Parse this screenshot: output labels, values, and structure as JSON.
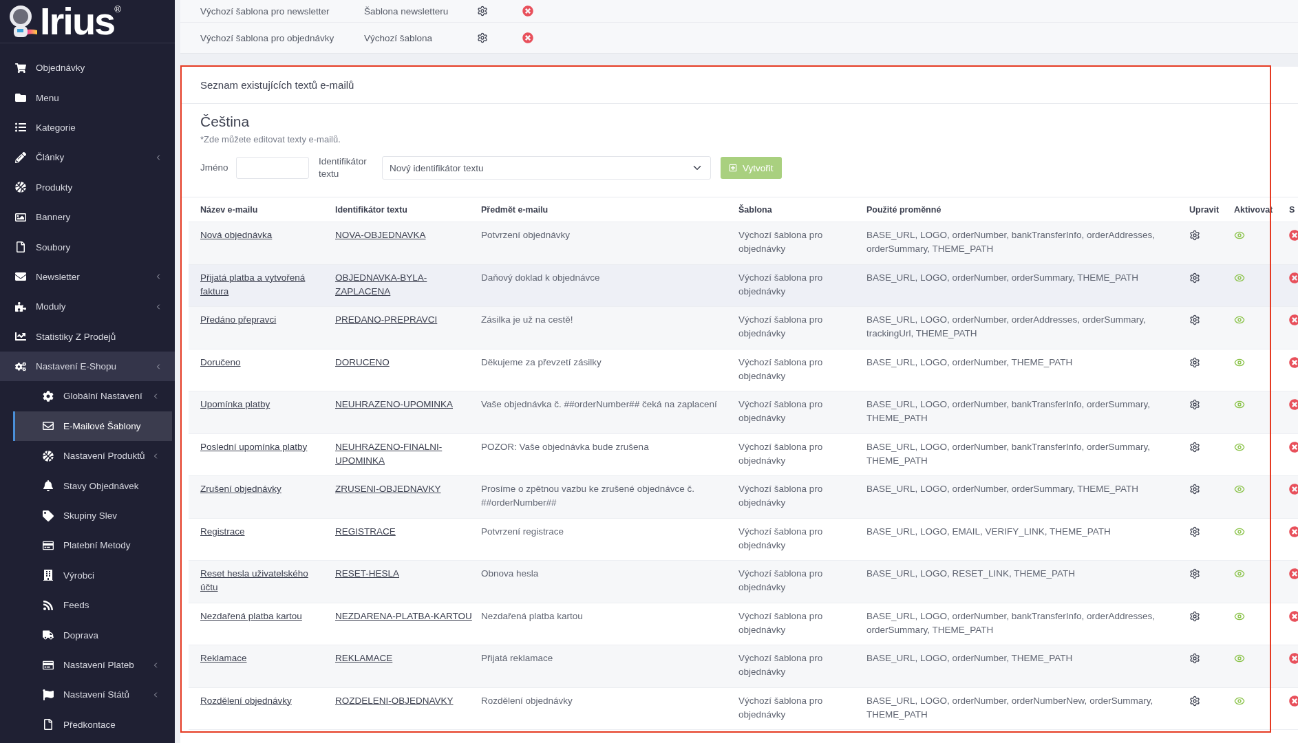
{
  "sidebar": {
    "logo": {
      "text": "Irius",
      "mark": "®"
    },
    "items": [
      {
        "label": "Objednávky",
        "has_submenu": false,
        "expanded": false,
        "selected": false
      },
      {
        "label": "Menu",
        "has_submenu": false,
        "expanded": false,
        "selected": false
      },
      {
        "label": "Kategorie",
        "has_submenu": false,
        "expanded": false,
        "selected": false
      },
      {
        "label": "Články",
        "has_submenu": true,
        "expanded": false,
        "selected": false
      },
      {
        "label": "Produkty",
        "has_submenu": false,
        "expanded": false,
        "selected": false
      },
      {
        "label": "Bannery",
        "has_submenu": false,
        "expanded": false,
        "selected": false
      },
      {
        "label": "Soubory",
        "has_submenu": false,
        "expanded": false,
        "selected": false
      },
      {
        "label": "Newsletter",
        "has_submenu": true,
        "expanded": false,
        "selected": false
      },
      {
        "label": "Moduly",
        "has_submenu": true,
        "expanded": false,
        "selected": false
      },
      {
        "label": "Statistiky Z Prodejů",
        "has_submenu": false,
        "expanded": false,
        "selected": false
      },
      {
        "label": "Nastavení E-Shopu",
        "has_submenu": true,
        "expanded": true,
        "selected": false,
        "children": [
          {
            "label": "Globální Nastavení",
            "has_submenu": true,
            "selected": false
          },
          {
            "label": "E-Mailové Šablony",
            "has_submenu": false,
            "selected": true
          },
          {
            "label": "Nastavení Produktů",
            "has_submenu": true,
            "selected": false
          },
          {
            "label": "Stavy Objednávek",
            "has_submenu": false,
            "selected": false
          },
          {
            "label": "Skupiny Slev",
            "has_submenu": false,
            "selected": false
          },
          {
            "label": "Platební Metody",
            "has_submenu": false,
            "selected": false
          },
          {
            "label": "Výrobci",
            "has_submenu": false,
            "selected": false
          },
          {
            "label": "Feeds",
            "has_submenu": false,
            "selected": false
          },
          {
            "label": "Doprava",
            "has_submenu": false,
            "selected": false
          },
          {
            "label": "Nastavení Plateb",
            "has_submenu": true,
            "selected": false
          },
          {
            "label": "Nastavení Států",
            "has_submenu": true,
            "selected": false
          },
          {
            "label": "Předkontace",
            "has_submenu": false,
            "selected": false
          }
        ]
      }
    ]
  },
  "templates": [
    {
      "name": "Výchozí šablona pro newsletter",
      "template": "Šablona newsletteru"
    },
    {
      "name": "Výchozí šablona pro objednávky",
      "template": "Výchozí šablona"
    }
  ],
  "texts_card": {
    "title": "Seznam existujících textů e-mailů",
    "language": "Čeština",
    "note": "*Zde můžete editovat texty e-mailů.",
    "form": {
      "name_label": "Jméno",
      "identifier_label": "Identifikátor textu",
      "identifier_value": "Nový identifikátor textu",
      "create_button": "Vytvořit"
    },
    "table": {
      "columns": [
        "Název e-mailu",
        "Identifikátor textu",
        "Předmět e-mailu",
        "Šablona",
        "Použité proměnné",
        "Upravit",
        "Aktivovat",
        "S"
      ],
      "rows": [
        {
          "name": "Nová objednávka",
          "identifier": "NOVA-OBJEDNAVKA",
          "subject": "Potvrzení objednávky",
          "template": "Výchozí šablona pro objednávky",
          "variables": "BASE_URL, LOGO, orderNumber, bankTransferInfo, orderAddresses, orderSummary, THEME_PATH",
          "active": true,
          "highlighted": false
        },
        {
          "name": "Přijatá platba a vytvořená faktura",
          "identifier": "OBJEDNAVKA-BYLA-ZAPLACENA",
          "subject": "Daňový doklad k objednávce",
          "template": "Výchozí šablona pro objednávky",
          "variables": "BASE_URL, LOGO, orderNumber, orderSummary, THEME_PATH",
          "active": true,
          "highlighted": true
        },
        {
          "name": "Předáno přepravci",
          "identifier": "PREDANO-PREPRAVCI",
          "subject": "Zásilka je už na cestě!",
          "template": "Výchozí šablona pro objednávky",
          "variables": "BASE_URL, LOGO, orderNumber, orderAddresses, orderSummary, trackingUrl, THEME_PATH",
          "active": true,
          "highlighted": false
        },
        {
          "name": "Doručeno",
          "identifier": "DORUCENO",
          "subject": "Děkujeme za převzetí zásilky",
          "template": "Výchozí šablona pro objednávky",
          "variables": "BASE_URL, LOGO, orderNumber, THEME_PATH",
          "active": true,
          "highlighted": false
        },
        {
          "name": "Upomínka platby",
          "identifier": "NEUHRAZENO-UPOMINKA",
          "subject": "Vaše objednávka č. ##orderNumber## čeká na zaplacení",
          "template": "Výchozí šablona pro objednávky",
          "variables": "BASE_URL, LOGO, orderNumber, bankTransferInfo, orderSummary, THEME_PATH",
          "active": true,
          "highlighted": false
        },
        {
          "name": "Poslední upomínka platby",
          "identifier": "NEUHRAZENO-FINALNI-UPOMINKA",
          "subject": "POZOR: Vaše objednávka bude zrušena",
          "template": "Výchozí šablona pro objednávky",
          "variables": "BASE_URL, LOGO, orderNumber, bankTransferInfo, orderSummary, THEME_PATH",
          "active": true,
          "highlighted": false
        },
        {
          "name": "Zrušení objednávky",
          "identifier": "ZRUSENI-OBJEDNAVKY",
          "subject": "Prosíme o zpětnou vazbu ke zrušené objednávce č. ##orderNumber##",
          "template": "Výchozí šablona pro objednávky",
          "variables": "BASE_URL, LOGO, orderNumber, orderSummary, THEME_PATH",
          "active": true,
          "highlighted": false
        },
        {
          "name": "Registrace",
          "identifier": "REGISTRACE",
          "subject": "Potvrzení registrace",
          "template": "Výchozí šablona pro objednávky",
          "variables": "BASE_URL, LOGO, EMAIL, VERIFY_LINK, THEME_PATH",
          "active": true,
          "highlighted": false
        },
        {
          "name": "Reset hesla uživatelského účtu",
          "identifier": "RESET-HESLA",
          "subject": "Obnova hesla",
          "template": "Výchozí šablona pro objednávky",
          "variables": "BASE_URL, LOGO, RESET_LINK, THEME_PATH",
          "active": true,
          "highlighted": false
        },
        {
          "name": "Nezdařená platba kartou",
          "identifier": "NEZDARENA-PLATBA-KARTOU",
          "subject": "Nezdařená platba kartou",
          "template": "Výchozí šablona pro objednávky",
          "variables": "BASE_URL, LOGO, orderNumber, bankTransferInfo, orderAddresses, orderSummary, THEME_PATH",
          "active": true,
          "highlighted": false
        },
        {
          "name": "Reklamace",
          "identifier": "REKLAMACE",
          "subject": "Přijatá reklamace",
          "template": "Výchozí šablona pro objednávky",
          "variables": "BASE_URL, LOGO, orderNumber, THEME_PATH",
          "active": true,
          "highlighted": false
        },
        {
          "name": "Rozdělení objednávky",
          "identifier": "ROZDELENI-OBJEDNAVKY",
          "subject": "Rozdělení objednávky",
          "template": "Výchozí šablona pro objednávky",
          "variables": "BASE_URL, LOGO, orderNumber, orderNumberNew, orderSummary, THEME_PATH",
          "active": true,
          "highlighted": false
        }
      ]
    }
  }
}
